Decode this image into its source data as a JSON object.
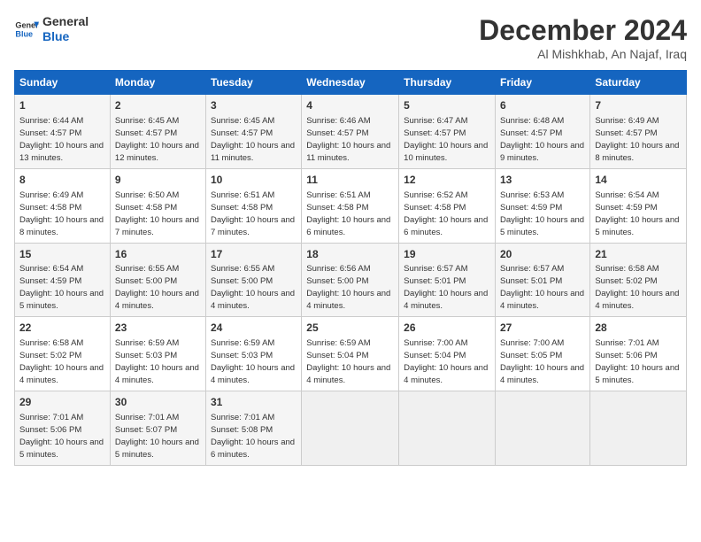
{
  "logo": {
    "line1": "General",
    "line2": "Blue"
  },
  "title": "December 2024",
  "location": "Al Mishkhab, An Najaf, Iraq",
  "days_of_week": [
    "Sunday",
    "Monday",
    "Tuesday",
    "Wednesday",
    "Thursday",
    "Friday",
    "Saturday"
  ],
  "weeks": [
    [
      {
        "day": "1",
        "sunrise": "6:44 AM",
        "sunset": "4:57 PM",
        "daylight": "10 hours and 13 minutes."
      },
      {
        "day": "2",
        "sunrise": "6:45 AM",
        "sunset": "4:57 PM",
        "daylight": "10 hours and 12 minutes."
      },
      {
        "day": "3",
        "sunrise": "6:45 AM",
        "sunset": "4:57 PM",
        "daylight": "10 hours and 11 minutes."
      },
      {
        "day": "4",
        "sunrise": "6:46 AM",
        "sunset": "4:57 PM",
        "daylight": "10 hours and 11 minutes."
      },
      {
        "day": "5",
        "sunrise": "6:47 AM",
        "sunset": "4:57 PM",
        "daylight": "10 hours and 10 minutes."
      },
      {
        "day": "6",
        "sunrise": "6:48 AM",
        "sunset": "4:57 PM",
        "daylight": "10 hours and 9 minutes."
      },
      {
        "day": "7",
        "sunrise": "6:49 AM",
        "sunset": "4:57 PM",
        "daylight": "10 hours and 8 minutes."
      }
    ],
    [
      {
        "day": "8",
        "sunrise": "6:49 AM",
        "sunset": "4:58 PM",
        "daylight": "10 hours and 8 minutes."
      },
      {
        "day": "9",
        "sunrise": "6:50 AM",
        "sunset": "4:58 PM",
        "daylight": "10 hours and 7 minutes."
      },
      {
        "day": "10",
        "sunrise": "6:51 AM",
        "sunset": "4:58 PM",
        "daylight": "10 hours and 7 minutes."
      },
      {
        "day": "11",
        "sunrise": "6:51 AM",
        "sunset": "4:58 PM",
        "daylight": "10 hours and 6 minutes."
      },
      {
        "day": "12",
        "sunrise": "6:52 AM",
        "sunset": "4:58 PM",
        "daylight": "10 hours and 6 minutes."
      },
      {
        "day": "13",
        "sunrise": "6:53 AM",
        "sunset": "4:59 PM",
        "daylight": "10 hours and 5 minutes."
      },
      {
        "day": "14",
        "sunrise": "6:54 AM",
        "sunset": "4:59 PM",
        "daylight": "10 hours and 5 minutes."
      }
    ],
    [
      {
        "day": "15",
        "sunrise": "6:54 AM",
        "sunset": "4:59 PM",
        "daylight": "10 hours and 5 minutes."
      },
      {
        "day": "16",
        "sunrise": "6:55 AM",
        "sunset": "5:00 PM",
        "daylight": "10 hours and 4 minutes."
      },
      {
        "day": "17",
        "sunrise": "6:55 AM",
        "sunset": "5:00 PM",
        "daylight": "10 hours and 4 minutes."
      },
      {
        "day": "18",
        "sunrise": "6:56 AM",
        "sunset": "5:00 PM",
        "daylight": "10 hours and 4 minutes."
      },
      {
        "day": "19",
        "sunrise": "6:57 AM",
        "sunset": "5:01 PM",
        "daylight": "10 hours and 4 minutes."
      },
      {
        "day": "20",
        "sunrise": "6:57 AM",
        "sunset": "5:01 PM",
        "daylight": "10 hours and 4 minutes."
      },
      {
        "day": "21",
        "sunrise": "6:58 AM",
        "sunset": "5:02 PM",
        "daylight": "10 hours and 4 minutes."
      }
    ],
    [
      {
        "day": "22",
        "sunrise": "6:58 AM",
        "sunset": "5:02 PM",
        "daylight": "10 hours and 4 minutes."
      },
      {
        "day": "23",
        "sunrise": "6:59 AM",
        "sunset": "5:03 PM",
        "daylight": "10 hours and 4 minutes."
      },
      {
        "day": "24",
        "sunrise": "6:59 AM",
        "sunset": "5:03 PM",
        "daylight": "10 hours and 4 minutes."
      },
      {
        "day": "25",
        "sunrise": "6:59 AM",
        "sunset": "5:04 PM",
        "daylight": "10 hours and 4 minutes."
      },
      {
        "day": "26",
        "sunrise": "7:00 AM",
        "sunset": "5:04 PM",
        "daylight": "10 hours and 4 minutes."
      },
      {
        "day": "27",
        "sunrise": "7:00 AM",
        "sunset": "5:05 PM",
        "daylight": "10 hours and 4 minutes."
      },
      {
        "day": "28",
        "sunrise": "7:01 AM",
        "sunset": "5:06 PM",
        "daylight": "10 hours and 5 minutes."
      }
    ],
    [
      {
        "day": "29",
        "sunrise": "7:01 AM",
        "sunset": "5:06 PM",
        "daylight": "10 hours and 5 minutes."
      },
      {
        "day": "30",
        "sunrise": "7:01 AM",
        "sunset": "5:07 PM",
        "daylight": "10 hours and 5 minutes."
      },
      {
        "day": "31",
        "sunrise": "7:01 AM",
        "sunset": "5:08 PM",
        "daylight": "10 hours and 6 minutes."
      },
      null,
      null,
      null,
      null
    ]
  ],
  "labels": {
    "sunrise": "Sunrise:",
    "sunset": "Sunset:",
    "daylight": "Daylight:"
  }
}
